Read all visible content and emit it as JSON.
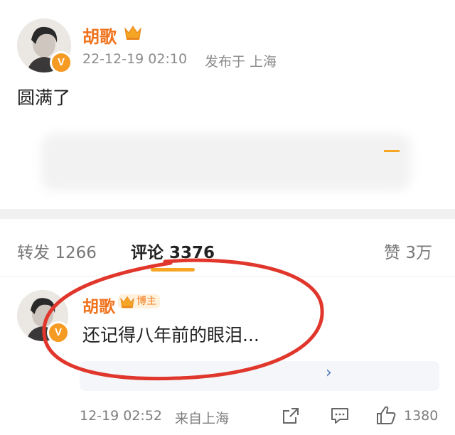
{
  "post": {
    "author": "胡歌",
    "timestamp": "22-12-19 02:10",
    "location": "发布于 上海",
    "text": "圆满了"
  },
  "tabs": {
    "repost_label": "转发",
    "repost_count": "1266",
    "comment_label": "评论",
    "comment_count": "3376",
    "like_label": "赞",
    "like_count": "3万"
  },
  "comment": {
    "author": "胡歌",
    "badge": "博主",
    "text": "还记得八年前的眼泪...",
    "timestamp": "12-19 02:52",
    "location": "来自上海",
    "like_count": "1380"
  },
  "colors": {
    "brand_orange": "#f0731e",
    "annotation_red": "#e0362b",
    "tab_underline": "#f6a623"
  }
}
